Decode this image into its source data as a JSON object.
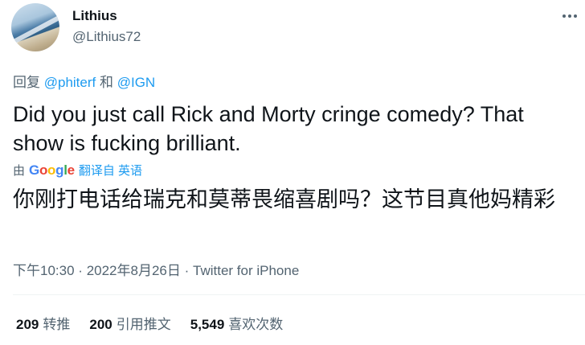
{
  "author": {
    "display_name": "Lithius",
    "handle": "@Lithius72"
  },
  "reply": {
    "prefix": "回复",
    "mention_1": "@phiterf",
    "conjunction": "和",
    "mention_2": "@IGN"
  },
  "tweet": {
    "text": "Did you just call Rick and Morty cringe comedy? That show is fucking brilliant.",
    "translation_prefix": "由",
    "translation_logo": [
      "G",
      "o",
      "o",
      "g",
      "l",
      "e"
    ],
    "translation_source": "翻译自 英语",
    "translated_text": "你刚打电话给瑞克和莫蒂畏缩喜剧吗？这节目真他妈精彩"
  },
  "meta": {
    "time": "下午10:30",
    "separator": "·",
    "date": "2022年8月26日",
    "source": "Twitter for iPhone"
  },
  "stats": {
    "retweets_count": "209",
    "retweets_label": "转推",
    "quotes_count": "200",
    "quotes_label": "引用推文",
    "likes_count": "5,549",
    "likes_label": "喜欢次数"
  },
  "icons": {
    "more": "more-dots-icon",
    "avatar": "beach-photo"
  },
  "colors": {
    "link": "#1d9bf0",
    "secondary_text": "#536471",
    "primary_text": "#0f1419",
    "divider": "#eff3f4"
  }
}
